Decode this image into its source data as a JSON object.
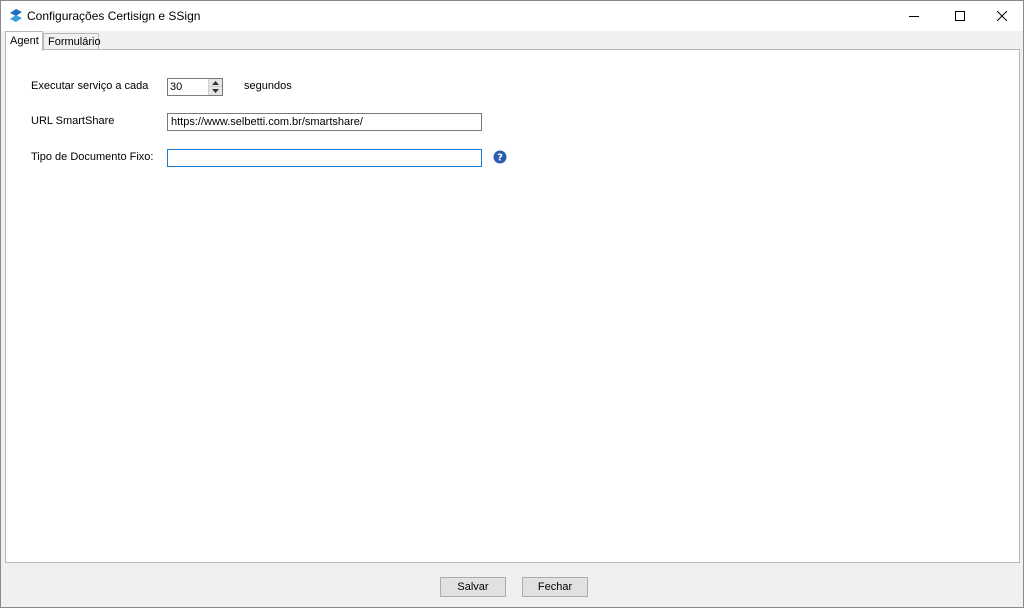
{
  "window": {
    "title": "Configurações Certisign e SSign",
    "app_icon": "certisign-logo-icon",
    "controls": [
      "minimize-icon",
      "maximize-icon",
      "close-icon"
    ]
  },
  "tabs": [
    {
      "label": "Agent",
      "active": true
    },
    {
      "label": "Formulário",
      "active": false
    }
  ],
  "agent": {
    "interval_label": "Executar serviço a cada",
    "interval_value": "30",
    "interval_unit": "segundos",
    "url_label": "URL SmartShare",
    "url_value": "https://www.selbetti.com.br/smartshare/",
    "tipo_label": "Tipo de Documento Fixo:",
    "tipo_value": "",
    "help_icon": "help-icon"
  },
  "footer": {
    "save_label": "Salvar",
    "close_label": "Fechar"
  },
  "colors": {
    "accent": "#1e7bd4",
    "help": "#2a5db0",
    "window_bg": "#f0f0f0"
  }
}
